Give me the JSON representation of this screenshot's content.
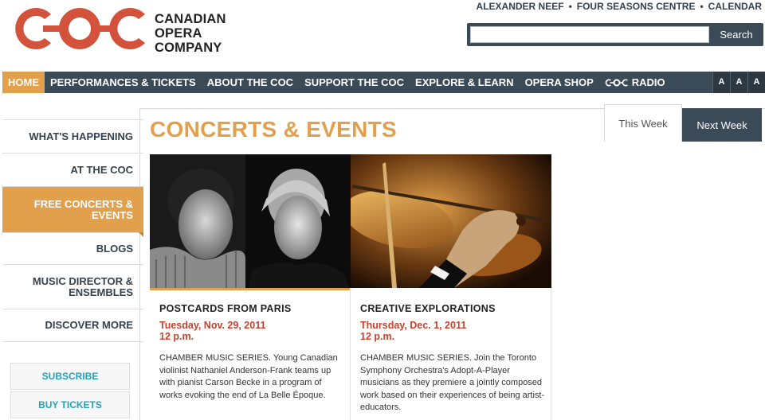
{
  "brand": {
    "logo_line1": "CANADIAN",
    "logo_line2": "OPERA",
    "logo_line3": "COMPANY",
    "logo_color": "#d3523b"
  },
  "top_links": [
    "ALEXANDER NEEF",
    "FOUR SEASONS CENTRE",
    "CALENDAR"
  ],
  "search": {
    "placeholder": "",
    "button_label": "Search"
  },
  "nav": {
    "items": [
      "HOME",
      "PERFORMANCES & TICKETS",
      "ABOUT THE COC",
      "SUPPORT THE COC",
      "EXPLORE & LEARN",
      "OPERA SHOP"
    ],
    "radio_label": "RADIO",
    "font_sizes": [
      "A",
      "A",
      "A"
    ]
  },
  "sidebar": {
    "items": [
      "WHAT'S HAPPENING",
      "AT THE COC",
      "FREE CONCERTS & EVENTS",
      "BLOGS",
      "MUSIC DIRECTOR & ENSEMBLES",
      "DISCOVER MORE"
    ],
    "buttons": [
      "SUBSCRIBE",
      "BUY TICKETS"
    ]
  },
  "main": {
    "title": "CONCERTS & EVENTS",
    "tabs": [
      "This Week",
      "Next Week"
    ]
  },
  "events": [
    {
      "title": "POSTCARDS FROM PARIS",
      "date": "Tuesday, Nov. 29, 2011",
      "time": "12 p.m.",
      "description": "CHAMBER MUSIC SERIES. Young Canadian violinist Nathaniel Anderson-Frank teams up with pianist Carson Becke in a program of works evoking the end of La Belle Époque."
    },
    {
      "title": "CREATIVE EXPLORATIONS",
      "date": "Thursday, Dec. 1, 2011",
      "time": "12 p.m.",
      "description": "CHAMBER MUSIC SERIES. Join the Toronto Symphony Orchestra's Adopt-A-Player musicians as they premiere a jointly composed work based on their experiences of being artist-educators."
    }
  ],
  "colors": {
    "accent": "#e3a04c",
    "nav": "#3b4a57",
    "date_red": "#c9402c",
    "link_teal": "#28a0ba"
  }
}
